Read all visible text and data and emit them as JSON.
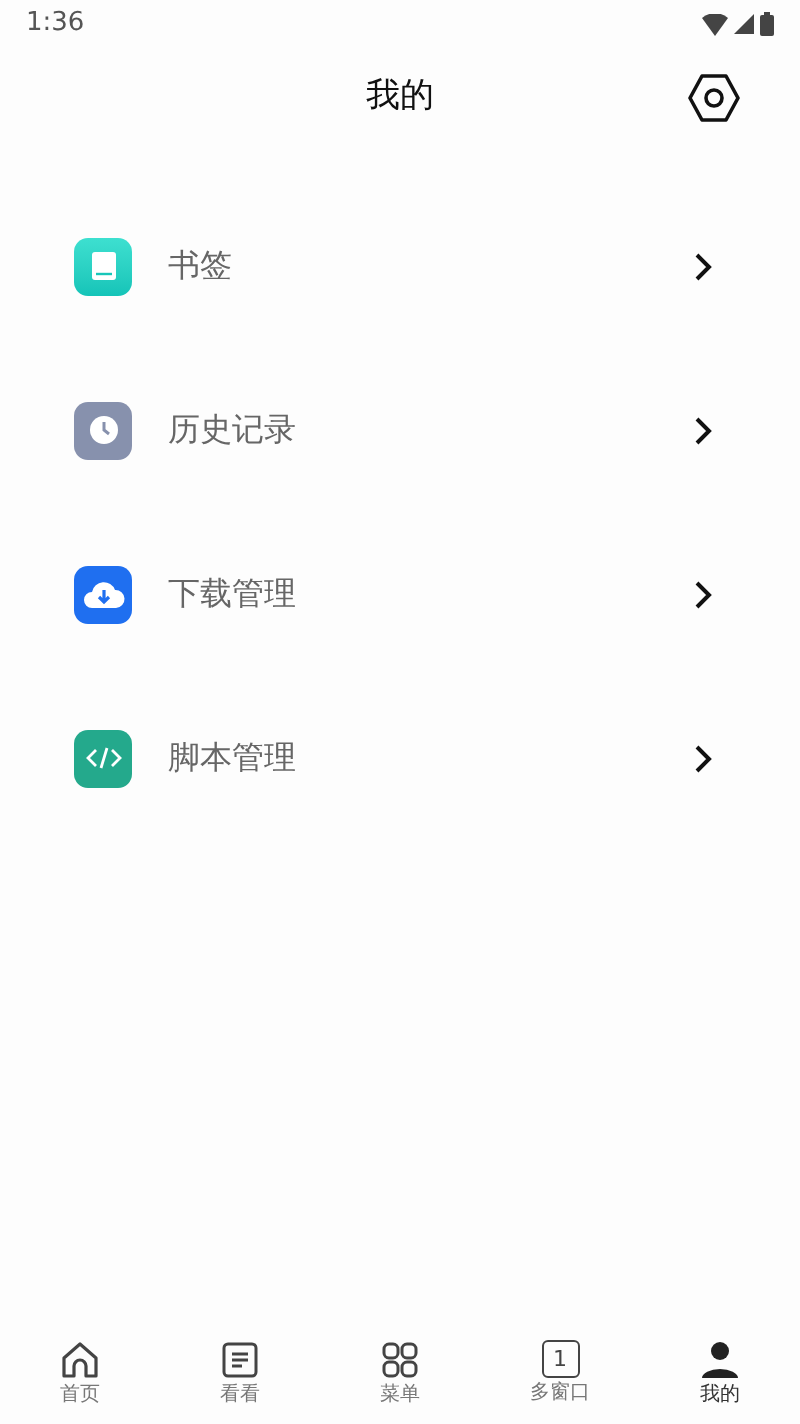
{
  "status_bar": {
    "time": "1:36"
  },
  "header": {
    "title": "我的"
  },
  "menu": [
    {
      "kind": "bookmark",
      "label": "书签"
    },
    {
      "kind": "history",
      "label": "历史记录"
    },
    {
      "kind": "download",
      "label": "下载管理"
    },
    {
      "kind": "script",
      "label": "脚本管理"
    }
  ],
  "tabs": [
    {
      "kind": "home",
      "label": "首页",
      "selected": false
    },
    {
      "kind": "read",
      "label": "看看",
      "selected": false
    },
    {
      "kind": "menu",
      "label": "菜单",
      "selected": false
    },
    {
      "kind": "windows",
      "label": "多窗口",
      "count": "1",
      "selected": false
    },
    {
      "kind": "me",
      "label": "我的",
      "selected": true
    }
  ]
}
